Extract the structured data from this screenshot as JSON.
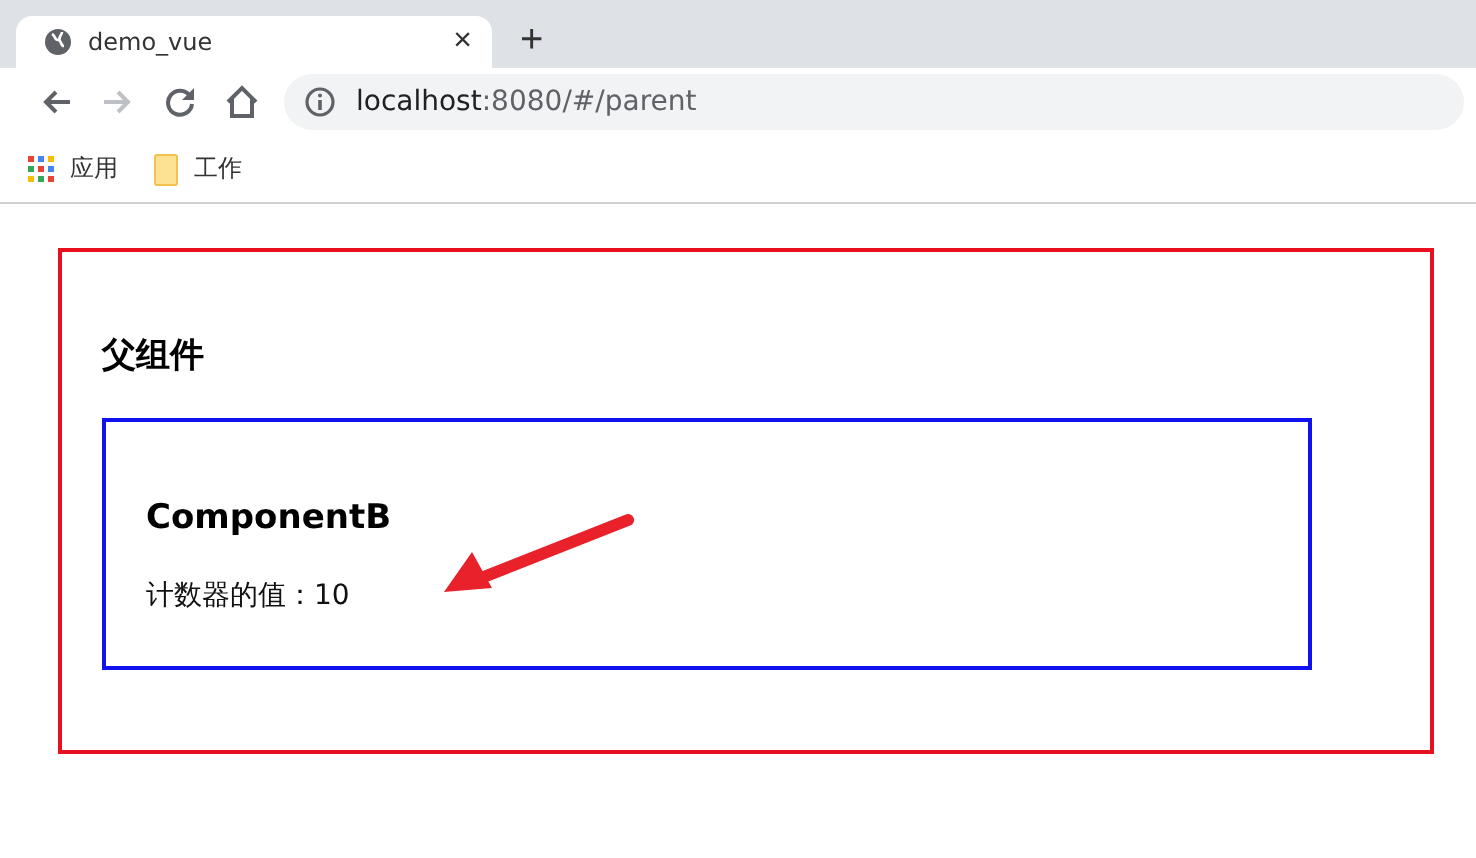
{
  "tabs": [
    {
      "title": "demo_vue",
      "selected": true,
      "close": "×"
    }
  ],
  "new_tab": "+",
  "nav_buttons": [
    {
      "kind": "back",
      "disabled": false
    },
    {
      "kind": "forward",
      "disabled": true
    },
    {
      "kind": "reload",
      "disabled": false
    },
    {
      "kind": "home",
      "disabled": false
    }
  ],
  "address": {
    "host": "localhost",
    "path": ":8080/#/parent"
  },
  "bookmarks": [
    {
      "kind": "apps",
      "label": "应用"
    },
    {
      "kind": "folder",
      "label": "工作"
    }
  ],
  "page": {
    "heading": "父组件",
    "child": {
      "heading": "ComponentB",
      "counter": "计数器的值：10"
    }
  }
}
